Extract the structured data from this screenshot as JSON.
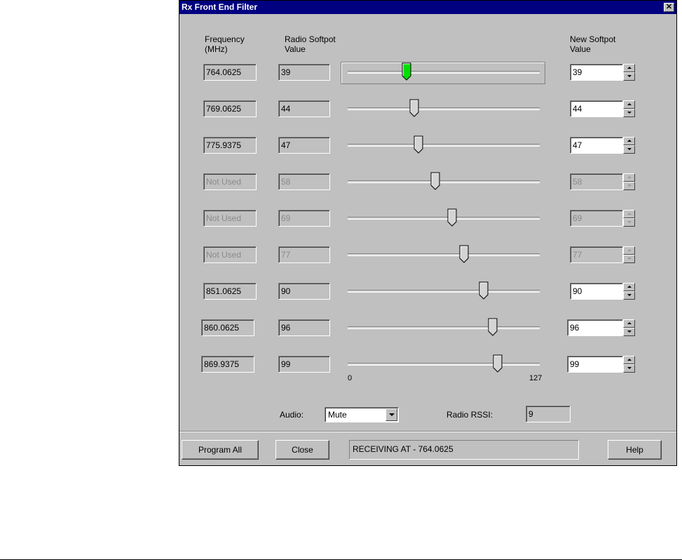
{
  "window": {
    "title": "Rx Front End Filter"
  },
  "headers": {
    "frequency": "Frequency\n(MHz)",
    "radio_softpot": "Radio Softpot\nValue",
    "new_softpot": "New Softpot\nValue"
  },
  "slider_range": {
    "min": 0,
    "max": 127,
    "min_label": "0",
    "max_label": "127"
  },
  "rows": [
    {
      "frequency": "764.0625",
      "radio_value": "39",
      "new_value": "39",
      "slider_value": 39,
      "enabled": true,
      "focused": true
    },
    {
      "frequency": "769.0625",
      "radio_value": "44",
      "new_value": "44",
      "slider_value": 44,
      "enabled": true
    },
    {
      "frequency": "775.9375",
      "radio_value": "47",
      "new_value": "47",
      "slider_value": 47,
      "enabled": true
    },
    {
      "frequency": "Not Used",
      "radio_value": "58",
      "new_value": "58",
      "slider_value": 58,
      "enabled": false
    },
    {
      "frequency": "Not Used",
      "radio_value": "69",
      "new_value": "69",
      "slider_value": 69,
      "enabled": false
    },
    {
      "frequency": "Not Used",
      "radio_value": "77",
      "new_value": "77",
      "slider_value": 77,
      "enabled": false
    },
    {
      "frequency": "851.0625",
      "radio_value": "90",
      "new_value": "90",
      "slider_value": 90,
      "enabled": true
    },
    {
      "frequency": "860.0625",
      "radio_value": "96",
      "new_value": "96",
      "slider_value": 96,
      "enabled": true
    },
    {
      "frequency": "869.9375",
      "radio_value": "99",
      "new_value": "99",
      "slider_value": 99,
      "enabled": true
    }
  ],
  "audio": {
    "label": "Audio:",
    "selected": "Mute"
  },
  "rssi": {
    "label": "Radio RSSI:",
    "value": "9"
  },
  "buttons": {
    "program_all": "Program All",
    "close": "Close",
    "help": "Help"
  },
  "status": {
    "text": "RECEIVING AT - 764.0625"
  },
  "colors": {
    "title_bar": "#000080",
    "dialog_face": "#c0c0c0",
    "active_thumb": "#00e000"
  },
  "icons": {
    "close": "close-icon",
    "spin_up": "spin-up-arrow-icon",
    "spin_down": "spin-down-arrow-icon",
    "combo": "chevron-down-icon"
  }
}
